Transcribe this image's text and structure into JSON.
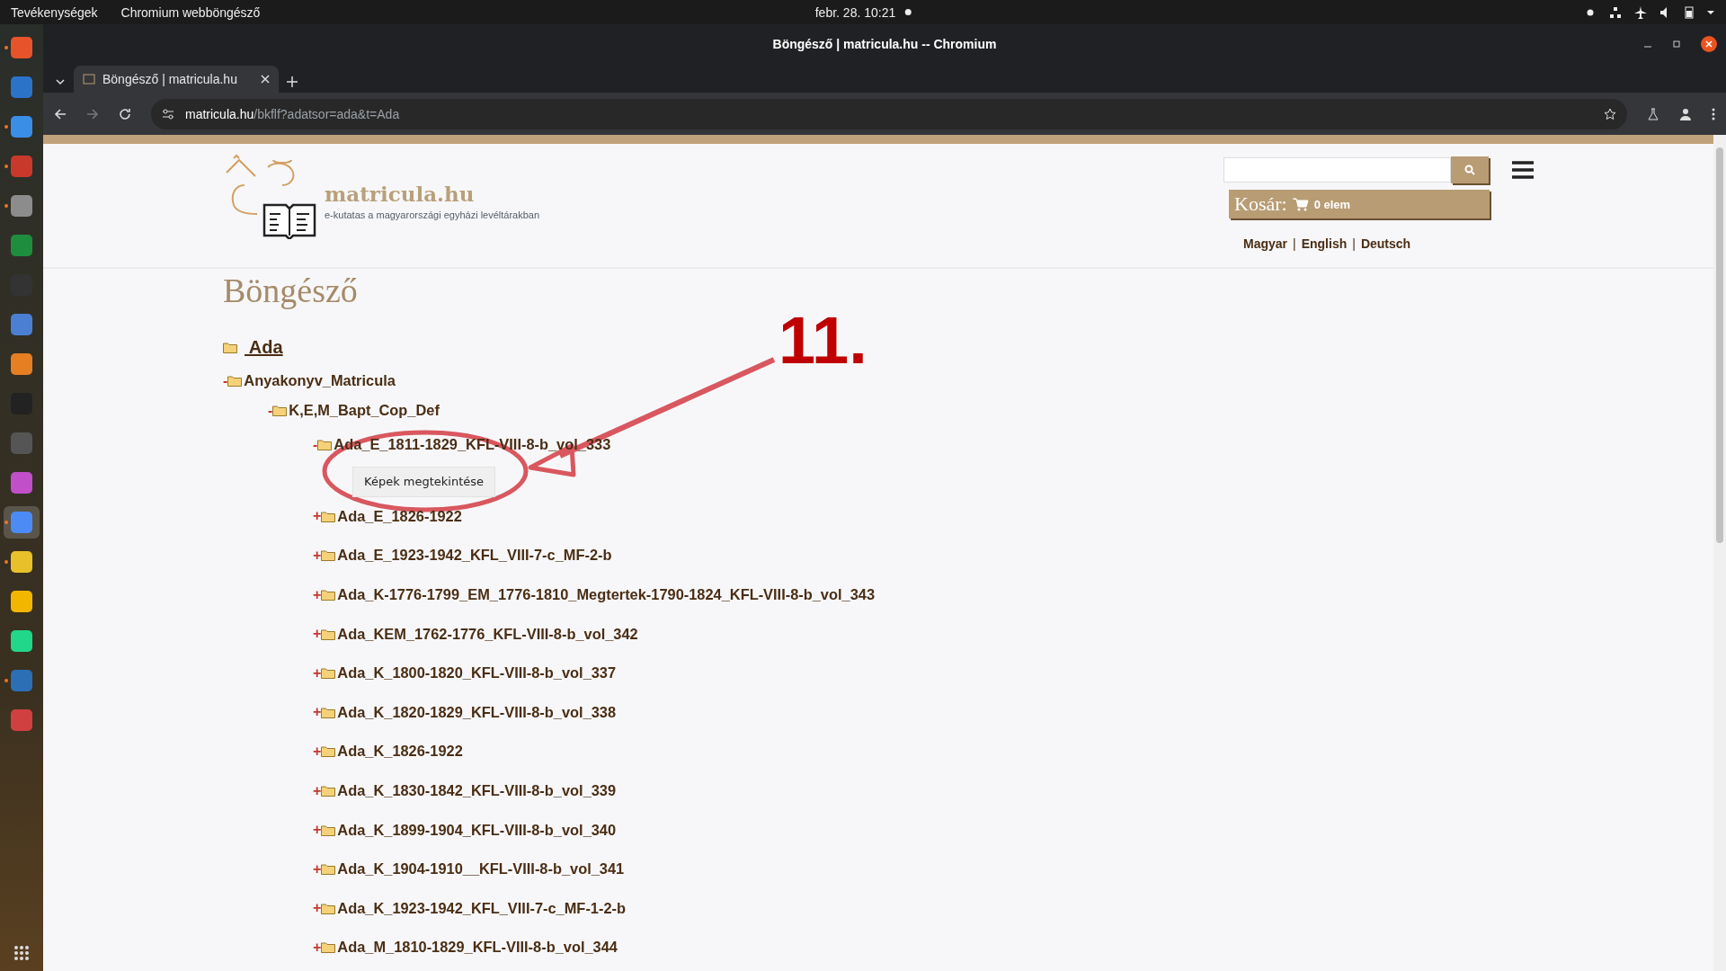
{
  "top_bar": {
    "activities": "Tevékenységek",
    "app_menu": "Chromium webböngésző",
    "clock": "febr. 28.  10:21"
  },
  "dock": [
    {
      "color": "#e8542a",
      "running": true,
      "selected": false
    },
    {
      "color": "#2a73c9",
      "running": false,
      "selected": false
    },
    {
      "color": "#3a8ee6",
      "running": true,
      "selected": false
    },
    {
      "color": "#c8392b",
      "running": true,
      "selected": false
    },
    {
      "color": "#8c8c8c",
      "running": true,
      "selected": false
    },
    {
      "color": "#1e8e3e",
      "running": false,
      "selected": false
    },
    {
      "color": "#333333",
      "running": false,
      "selected": false
    },
    {
      "color": "#4a7fd4",
      "running": false,
      "selected": false
    },
    {
      "color": "#e67e22",
      "running": false,
      "selected": false
    },
    {
      "color": "#222222",
      "running": false,
      "selected": false
    },
    {
      "color": "#555555",
      "running": false,
      "selected": false
    },
    {
      "color": "#c04fc9",
      "running": false,
      "selected": false
    },
    {
      "color": "#4c8bf5",
      "running": true,
      "selected": true
    },
    {
      "color": "#e8c02a",
      "running": true,
      "selected": false
    },
    {
      "color": "#f2b600",
      "running": false,
      "selected": false
    },
    {
      "color": "#21d789",
      "running": false,
      "selected": false
    },
    {
      "color": "#2c6fb5",
      "running": true,
      "selected": false
    },
    {
      "color": "#d04040",
      "running": false,
      "selected": false
    }
  ],
  "window": {
    "title": "Böngésző | matricula.hu -- Chromium"
  },
  "tabs": [
    {
      "label": "Böngésző | matricula.hu",
      "selected": true
    }
  ],
  "address_bar": {
    "host": "matricula.hu",
    "path": "/bkflf?adatsor=ada&t=Ada"
  },
  "site_header": {
    "logo_title": "matricula.hu",
    "logo_tagline": "e-kutatas a magyarországi egyházi levéltárakban",
    "cart_label": "Kosár:",
    "cart_count": "0 elem",
    "languages": [
      "Magyar",
      "English",
      "Deutsch"
    ],
    "separator": "|"
  },
  "page": {
    "title": "Böngésző"
  },
  "tree": {
    "label": " Ada",
    "children": [
      {
        "toggle": "-",
        "label": "Anyakonyv_Matricula",
        "children": [
          {
            "toggle": "-",
            "label": "K,E,M_Bapt_Cop_Def",
            "children": [
              {
                "toggle": "-",
                "label": "Ada_E_1811-1829_KFL-VIII-8-b_vol_333",
                "button": "Képek megtekintése"
              },
              {
                "toggle": "+",
                "label": "Ada_E_1826-1922"
              },
              {
                "toggle": "+",
                "label": "Ada_E_1923-1942_KFL_VIII-7-c_MF-2-b"
              },
              {
                "toggle": "+",
                "label": "Ada_K-1776-1799_EM_1776-1810_Megtertek-1790-1824_KFL-VIII-8-b_vol_343"
              },
              {
                "toggle": "+",
                "label": "Ada_KEM_1762-1776_KFL-VIII-8-b_vol_342"
              },
              {
                "toggle": "+",
                "label": "Ada_K_1800-1820_KFL-VIII-8-b_vol_337"
              },
              {
                "toggle": "+",
                "label": "Ada_K_1820-1829_KFL-VIII-8-b_vol_338"
              },
              {
                "toggle": "+",
                "label": "Ada_K_1826-1922"
              },
              {
                "toggle": "+",
                "label": "Ada_K_1830-1842_KFL-VIII-8-b_vol_339"
              },
              {
                "toggle": "+",
                "label": "Ada_K_1899-1904_KFL-VIII-8-b_vol_340"
              },
              {
                "toggle": "+",
                "label": "Ada_K_1904-1910__KFL-VIII-8-b_vol_341"
              },
              {
                "toggle": "+",
                "label": "Ada_K_1923-1942_KFL_VIII-7-c_MF-1-2-b"
              },
              {
                "toggle": "+",
                "label": "Ada_M_1810-1829_KFL-VIII-8-b_vol_344"
              }
            ]
          }
        ]
      }
    ]
  },
  "annotation": {
    "label": "11."
  }
}
